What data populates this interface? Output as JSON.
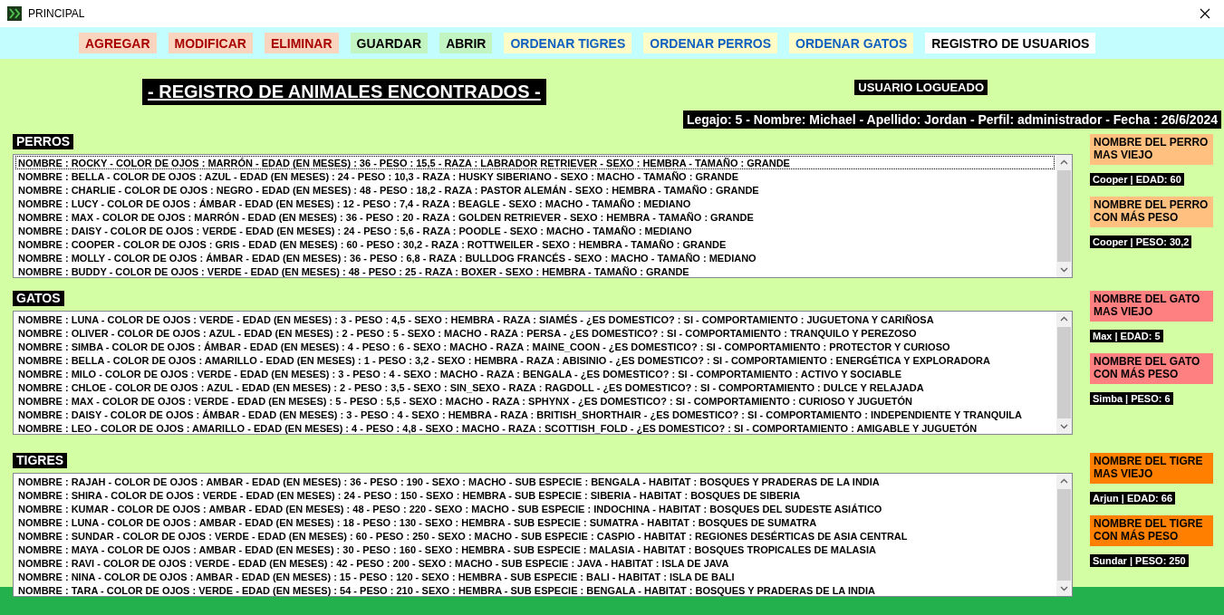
{
  "window": {
    "title": "PRINCIPAL"
  },
  "toolbar": [
    {
      "label": "AGREGAR",
      "kind": "edit"
    },
    {
      "label": "MODIFICAR",
      "kind": "edit"
    },
    {
      "label": "ELIMINAR",
      "kind": "edit"
    },
    {
      "label": "GUARDAR",
      "kind": "file"
    },
    {
      "label": "ABRIR",
      "kind": "file"
    },
    {
      "label": "ORDENAR TIGRES",
      "kind": "sort"
    },
    {
      "label": "ORDENAR PERROS",
      "kind": "sort"
    },
    {
      "label": "ORDENAR GATOS",
      "kind": "sort"
    },
    {
      "label": "REGISTRO DE USUARIOS",
      "kind": "users"
    }
  ],
  "header": {
    "title": "- REGISTRO DE ANIMALES ENCONTRADOS -",
    "user_label": "USUARIO LOGUEADO",
    "user_info": "Legajo: 5 - Nombre: Michael - Apellido: Jordan - Perfil: administrador - Fecha : 26/6/2024"
  },
  "sections": [
    {
      "heading": "PERROS",
      "rows": [
        {
          "text": "NOMBRE : ROCKY - COLOR DE OJOS : MARRÓN - EDAD (EN MESES) : 36 - PESO : 15,5 - RAZA : LABRADOR RETRIEVER - SEXO : HEMBRA - TAMAÑO : GRANDE",
          "focused": true
        },
        {
          "text": "NOMBRE : BELLA - COLOR DE OJOS : AZUL - EDAD (EN MESES) : 24 - PESO : 10,3 - RAZA : HUSKY SIBERIANO - SEXO : MACHO - TAMAÑO : GRANDE",
          "focused": false
        },
        {
          "text": "NOMBRE : CHARLIE - COLOR DE OJOS : NEGRO - EDAD (EN MESES) : 48 - PESO : 18,2 - RAZA : PASTOR ALEMÁN - SEXO : HEMBRA - TAMAÑO : GRANDE",
          "focused": false
        },
        {
          "text": "NOMBRE : LUCY - COLOR DE OJOS : ÁMBAR - EDAD (EN MESES) : 12 - PESO : 7,4 - RAZA : BEAGLE - SEXO : MACHO - TAMAÑO : MEDIANO",
          "focused": false
        },
        {
          "text": "NOMBRE : MAX - COLOR DE OJOS : MARRÓN - EDAD (EN MESES) : 36 - PESO : 20 - RAZA : GOLDEN RETRIEVER - SEXO : HEMBRA - TAMAÑO : GRANDE",
          "focused": false
        },
        {
          "text": "NOMBRE : DAISY - COLOR DE OJOS : VERDE - EDAD (EN MESES) : 24 - PESO : 5,6 - RAZA : POODLE - SEXO : MACHO - TAMAÑO : MEDIANO",
          "focused": false
        },
        {
          "text": "NOMBRE : COOPER - COLOR DE OJOS : GRIS - EDAD (EN MESES) : 60 - PESO : 30,2 - RAZA : ROTTWEILER - SEXO : HEMBRA - TAMAÑO : GRANDE",
          "focused": false
        },
        {
          "text": "NOMBRE : MOLLY - COLOR DE OJOS : ÁMBAR - EDAD (EN MESES) : 36 - PESO : 6,8 - RAZA : BULLDOG FRANCÉS - SEXO : MACHO - TAMAÑO : MEDIANO",
          "focused": false
        },
        {
          "text": "NOMBRE : BUDDY - COLOR DE OJOS : VERDE - EDAD (EN MESES) : 48 - PESO : 25 - RAZA : BOXER - SEXO : HEMBRA - TAMAÑO : GRANDE",
          "focused": false
        }
      ],
      "stats": [
        {
          "label": "NOMBRE DEL PERRO MAS VIEJO",
          "result": "Cooper | EDAD: 60",
          "color": "#ffc080"
        },
        {
          "label": "NOMBRE DEL PERRO CON MÁS PESO",
          "result": "Cooper | PESO: 30,2",
          "color": "#ffc080"
        }
      ]
    },
    {
      "heading": "GATOS",
      "rows": [
        {
          "text": "NOMBRE : LUNA - COLOR DE OJOS : VERDE - EDAD (EN MESES) : 3 - PESO : 4,5 - SEXO : HEMBRA - RAZA : SIAMÉS - ¿ES DOMESTICO? : SI - COMPORTAMIENTO : JUGUETONA Y CARIÑOSA",
          "focused": false
        },
        {
          "text": "NOMBRE : OLIVER - COLOR DE OJOS : AZUL - EDAD (EN MESES) : 2 - PESO : 5 - SEXO : MACHO - RAZA : PERSA - ¿ES DOMESTICO? : SI - COMPORTAMIENTO : TRANQUILO Y PEREZOSO",
          "focused": false
        },
        {
          "text": "NOMBRE : SIMBA - COLOR DE OJOS : ÁMBAR - EDAD (EN MESES) : 4 - PESO : 6 - SEXO : MACHO - RAZA : MAINE_COON - ¿ES DOMESTICO? : SI - COMPORTAMIENTO : PROTECTOR Y CURIOSO",
          "focused": false
        },
        {
          "text": "NOMBRE : BELLA - COLOR DE OJOS : AMARILLO - EDAD (EN MESES) : 1 - PESO : 3,2 - SEXO : HEMBRA - RAZA : ABISINIO - ¿ES DOMESTICO? : SI - COMPORTAMIENTO : ENERGÉTICA Y EXPLORADORA",
          "focused": false
        },
        {
          "text": "NOMBRE : MILO - COLOR DE OJOS : VERDE - EDAD (EN MESES) : 3 - PESO : 4 - SEXO : MACHO - RAZA : BENGALA - ¿ES DOMESTICO? : SI - COMPORTAMIENTO : ACTIVO Y SOCIABLE",
          "focused": false
        },
        {
          "text": "NOMBRE : CHLOE - COLOR DE OJOS : AZUL - EDAD (EN MESES) : 2 - PESO : 3,5 - SEXO : SIN_SEXO - RAZA : RAGDOLL - ¿ES DOMESTICO? : SI - COMPORTAMIENTO : DULCE Y RELAJADA",
          "focused": false
        },
        {
          "text": "NOMBRE : MAX - COLOR DE OJOS : VERDE - EDAD (EN MESES) : 5 - PESO : 5,5 - SEXO : MACHO - RAZA : SPHYNX - ¿ES DOMESTICO? : SI - COMPORTAMIENTO : CURIOSO Y JUGUETÓN",
          "focused": false
        },
        {
          "text": "NOMBRE : DAISY - COLOR DE OJOS : ÁMBAR - EDAD (EN MESES) : 3 - PESO : 4 - SEXO : HEMBRA - RAZA : BRITISH_SHORTHAIR - ¿ES DOMESTICO? : SI - COMPORTAMIENTO : INDEPENDIENTE Y TRANQUILA",
          "focused": false
        },
        {
          "text": "NOMBRE : LEO - COLOR DE OJOS : AMARILLO - EDAD (EN MESES) : 4 - PESO : 4,8 - SEXO : MACHO - RAZA : SCOTTISH_FOLD - ¿ES DOMESTICO? : SI - COMPORTAMIENTO : AMIGABLE Y JUGUETÓN",
          "focused": false
        }
      ],
      "stats": [
        {
          "label": "NOMBRE DEL GATO MAS VIEJO",
          "result": "Max | EDAD: 5",
          "color": "#ff8080"
        },
        {
          "label": "NOMBRE DEL GATO CON MÁS PESO",
          "result": "Simba | PESO: 6",
          "color": "#ff8080"
        }
      ]
    },
    {
      "heading": "TIGRES",
      "rows": [
        {
          "text": "NOMBRE : RAJAH - COLOR DE OJOS : AMBAR - EDAD (EN MESES) : 36 - PESO : 190 - SEXO : MACHO - SUB ESPECIE : BENGALA - HABITAT : BOSQUES Y PRADERAS DE LA INDIA",
          "focused": false
        },
        {
          "text": "NOMBRE : SHIRA - COLOR DE OJOS : VERDE - EDAD (EN MESES) : 24 - PESO : 150 - SEXO : HEMBRA - SUB ESPECIE : SIBERIA - HABITAT : BOSQUES DE SIBERIA",
          "focused": false
        },
        {
          "text": "NOMBRE : KUMAR - COLOR DE OJOS : AMBAR - EDAD (EN MESES) : 48 - PESO : 220 - SEXO : MACHO - SUB ESPECIE : INDOCHINA - HABITAT : BOSQUES DEL SUDESTE ASIÁTICO",
          "focused": false
        },
        {
          "text": "NOMBRE : LUNA - COLOR DE OJOS : AMBAR - EDAD (EN MESES) : 18 - PESO : 130 - SEXO : HEMBRA - SUB ESPECIE : SUMATRA - HABITAT : BOSQUES DE SUMATRA",
          "focused": false
        },
        {
          "text": "NOMBRE : SUNDAR - COLOR DE OJOS : VERDE - EDAD (EN MESES) : 60 - PESO : 250 - SEXO : MACHO - SUB ESPECIE : CASPIO - HABITAT : REGIONES DESÉRTICAS DE ASIA CENTRAL",
          "focused": false
        },
        {
          "text": "NOMBRE : MAYA - COLOR DE OJOS : AMBAR - EDAD (EN MESES) : 30 - PESO : 160 - SEXO : HEMBRA - SUB ESPECIE : MALASIA - HABITAT : BOSQUES TROPICALES DE MALASIA",
          "focused": false
        },
        {
          "text": "NOMBRE : RAVI - COLOR DE OJOS : VERDE - EDAD (EN MESES) : 42 - PESO : 200 - SEXO : MACHO - SUB ESPECIE : JAVA - HABITAT : ISLA DE JAVA",
          "focused": false
        },
        {
          "text": "NOMBRE : NINA - COLOR DE OJOS : AMBAR - EDAD (EN MESES) : 15 - PESO : 120 - SEXO : HEMBRA - SUB ESPECIE : BALI - HABITAT : ISLA DE BALI",
          "focused": false
        },
        {
          "text": "NOMBRE : TARA - COLOR DE OJOS : VERDE - EDAD (EN MESES) : 54 - PESO : 210 - SEXO : HEMBRA - SUB ESPECIE : BENGALA - HABITAT : BOSQUES Y PRADERAS DE LA INDIA",
          "focused": false
        }
      ],
      "stats": [
        {
          "label": "NOMBRE DEL TIGRE MAS VIEJO",
          "result": "Arjun | EDAD: 66",
          "color": "#ff8000"
        },
        {
          "label": "NOMBRE DEL TIGRE CON MÁS PESO",
          "result": "Sundar | PESO: 250",
          "color": "#ff8000"
        }
      ]
    }
  ]
}
